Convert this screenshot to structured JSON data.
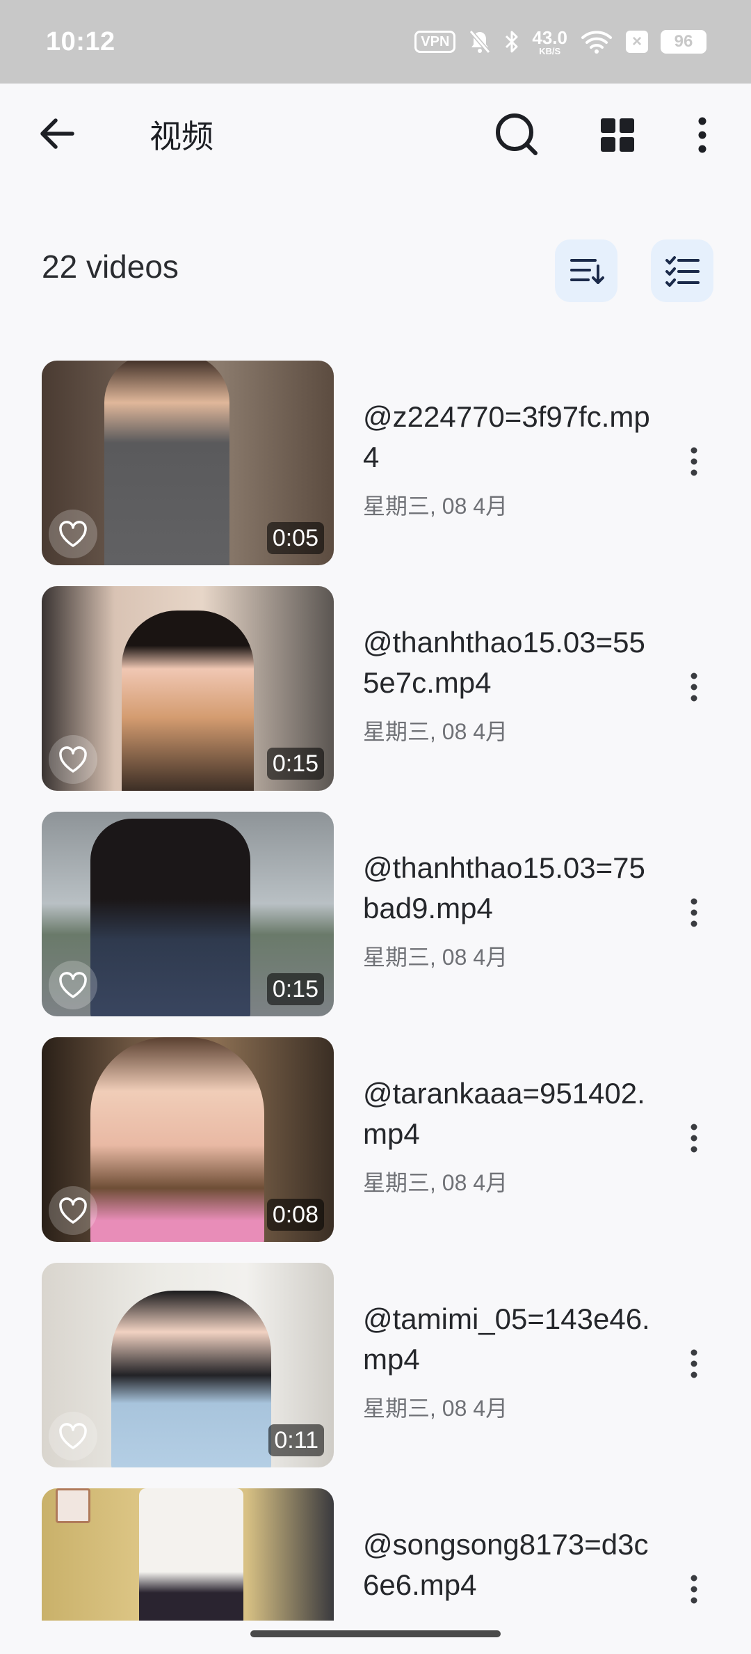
{
  "status_bar": {
    "time": "10:12",
    "vpn": "VPN",
    "net_speed_value": "43.0",
    "net_speed_unit": "KB/S",
    "close_badge": "×",
    "battery": "96"
  },
  "app_bar": {
    "title": "视频"
  },
  "header": {
    "count": "22 videos"
  },
  "videos": [
    {
      "title": "@z224770=3f97fc.mp4",
      "date": "星期三, 08 4月",
      "duration": "0:05"
    },
    {
      "title": "@thanhthao15.03=555e7c.mp4",
      "date": "星期三, 08 4月",
      "duration": "0:15"
    },
    {
      "title": "@thanhthao15.03=75bad9.mp4",
      "date": "星期三, 08 4月",
      "duration": "0:15"
    },
    {
      "title": "@tarankaaa=951402.mp4",
      "date": "星期三, 08 4月",
      "duration": "0:08"
    },
    {
      "title": "@tamimi_05=143e46.mp4",
      "date": "星期三, 08 4月",
      "duration": "0:11"
    },
    {
      "title": "@songsong8173=d3c6e6.mp4",
      "date": "",
      "duration": ""
    }
  ],
  "icons": {
    "back": "arrow-left-icon",
    "search": "search-icon",
    "grid": "grid-view-icon",
    "more": "more-vertical-icon",
    "sort": "sort-icon",
    "select": "checklist-icon",
    "favorite": "heart-outline-icon"
  },
  "colors": {
    "background": "#f8f8fa",
    "status_bar": "#c8c8c8",
    "chip_bg": "#e6f0fc",
    "chip_icon": "#1b2a4a"
  }
}
